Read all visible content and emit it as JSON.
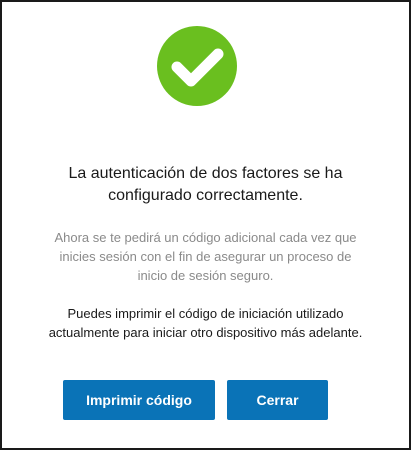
{
  "dialog": {
    "icon": "checkmark-circle-icon",
    "accent_color": "#6abf1f",
    "button_color": "#0a73b7",
    "title_line1": "La autenticación de dos factores se ha",
    "title_line2": "configurado correctamente.",
    "description_line1": "Ahora se te pedirá un código adicional cada vez que",
    "description_line2": "inicies sesión con el fin de asegurar un proceso de",
    "description_line3": "inicio de sesión seguro.",
    "print_note_line1": "Puedes imprimir el código de iniciación utilizado",
    "print_note_line2": "actualmente para iniciar otro dispositivo más adelante.",
    "print_button_label": "Imprimir código",
    "close_button_label": "Cerrar"
  }
}
